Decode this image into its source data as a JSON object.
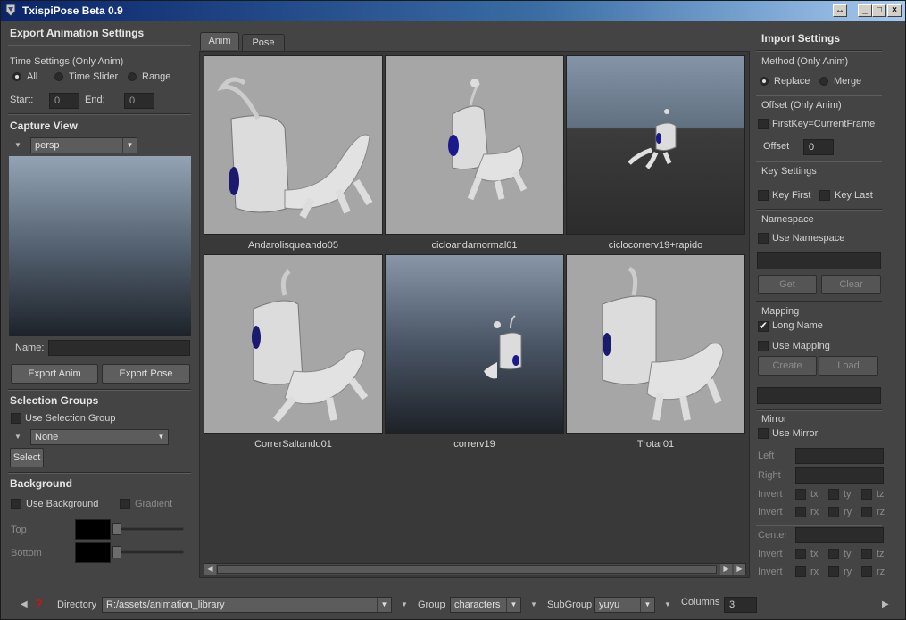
{
  "window": {
    "title": "TxispiPose Beta 0.9"
  },
  "left": {
    "export_header": "Export Animation Settings",
    "time_settings_label": "Time Settings (Only Anim)",
    "time_options": [
      "All",
      "Time Slider",
      "Range"
    ],
    "time_selected": "All",
    "start_label": "Start:",
    "start_value": "0",
    "end_label": "End:",
    "end_value": "0",
    "capture_header": "Capture View",
    "camera_value": "persp",
    "name_label": "Name:",
    "name_value": "",
    "export_anim_label": "Export Anim",
    "export_pose_label": "Export Pose",
    "selection_header": "Selection Groups",
    "use_selection_group_label": "Use Selection Group",
    "group_value": "None",
    "select_label": "Select",
    "background_header": "Background",
    "use_background_label": "Use Background",
    "gradient_label": "Gradient",
    "top_label": "Top",
    "bottom_label": "Bottom",
    "top_color": "#000000",
    "bottom_color": "#000000"
  },
  "main": {
    "tabs": [
      "Anim",
      "Pose"
    ],
    "active_tab": "Anim",
    "items": [
      {
        "name": "Andarolisqueando05"
      },
      {
        "name": "cicloandarnormal01"
      },
      {
        "name": "ciclocorrerv19+rapido"
      },
      {
        "name": "CorrerSaltando01"
      },
      {
        "name": "correrv19"
      },
      {
        "name": "Trotar01"
      }
    ]
  },
  "right": {
    "import_header": "Import Settings",
    "method_label": "Method (Only Anim)",
    "method_options": [
      "Replace",
      "Merge"
    ],
    "method_selected": "Replace",
    "offset_section_label": "Offset (Only Anim)",
    "firstkey_label": "FirstKey=CurrentFrame",
    "offset_label": "Offset",
    "offset_value": "0",
    "key_settings_label": "Key Settings",
    "key_first_label": "Key First",
    "key_last_label": "Key Last",
    "namespace_label": "Namespace",
    "use_namespace_label": "Use Namespace",
    "namespace_value": "",
    "get_label": "Get",
    "clear_label": "Clear",
    "mapping_label": "Mapping",
    "long_name_label": "Long Name",
    "use_mapping_label": "Use Mapping",
    "create_label": "Create",
    "load_label": "Load",
    "mapping_value": "",
    "mirror_label": "Mirror",
    "use_mirror_label": "Use Mirror",
    "left_label": "Left",
    "right_label": "Right",
    "invert_label": "Invert",
    "center_label": "Center",
    "t_axes": [
      "tx",
      "ty",
      "tz"
    ],
    "r_axes": [
      "rx",
      "ry",
      "rz"
    ]
  },
  "bottom": {
    "directory_label": "Directory",
    "directory_value": "R:/assets/animation_library",
    "group_label": "Group",
    "group_value": "characters",
    "subgroup_label": "SubGroup",
    "subgroup_value": "yuyu",
    "columns_label": "Columns",
    "columns_value": "3"
  }
}
